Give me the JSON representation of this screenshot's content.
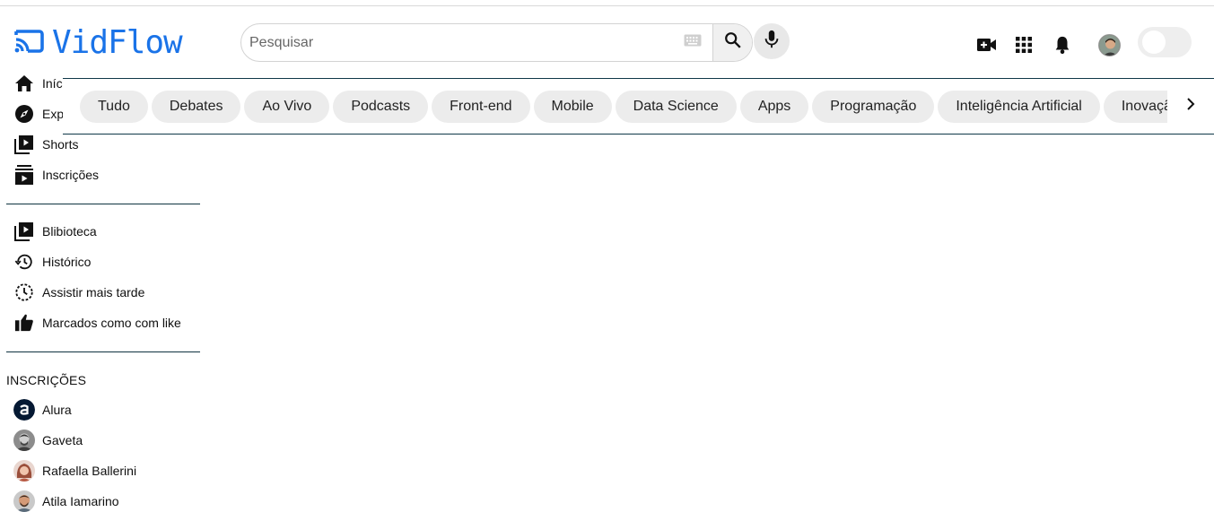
{
  "app": {
    "name": "VidFlow",
    "brand_color": "#1a73e8"
  },
  "search": {
    "placeholder": "Pesquisar",
    "value": ""
  },
  "header_icons": [
    "keyboard-icon",
    "search-icon",
    "mic-icon",
    "create-video-icon",
    "apps-grid-icon",
    "notifications-bell-icon",
    "avatar",
    "theme-toggle"
  ],
  "sidebar": {
    "main": [
      {
        "label": "Início",
        "icon": "home-icon"
      },
      {
        "label": "Explorar",
        "icon": "explore-icon"
      },
      {
        "label": "Shorts",
        "icon": "shorts-icon"
      },
      {
        "label": "Inscrições",
        "icon": "subscriptions-icon"
      }
    ],
    "library": [
      {
        "label": "Blibioteca",
        "icon": "library-icon"
      },
      {
        "label": "Histórico",
        "icon": "history-icon"
      },
      {
        "label": "Assistir mais tarde",
        "icon": "watch-later-icon"
      },
      {
        "label": "Marcados como com like",
        "icon": "like-icon"
      }
    ],
    "subscriptions_title": "INSCRIÇÕES",
    "subscriptions": [
      {
        "label": "Alura",
        "avatar": "alura-logo"
      },
      {
        "label": "Gaveta",
        "avatar": "gaveta-avatar"
      },
      {
        "label": "Rafaella Ballerini",
        "avatar": "rafaella-avatar"
      },
      {
        "label": "Atila Iamarino",
        "avatar": "atila-avatar"
      }
    ]
  },
  "chips": [
    "Tudo",
    "Debates",
    "Ao Vivo",
    "Podcasts",
    "Front-end",
    "Mobile",
    "Data Science",
    "Apps",
    "Programação",
    "Inteligência Artificial",
    "Inovação"
  ]
}
